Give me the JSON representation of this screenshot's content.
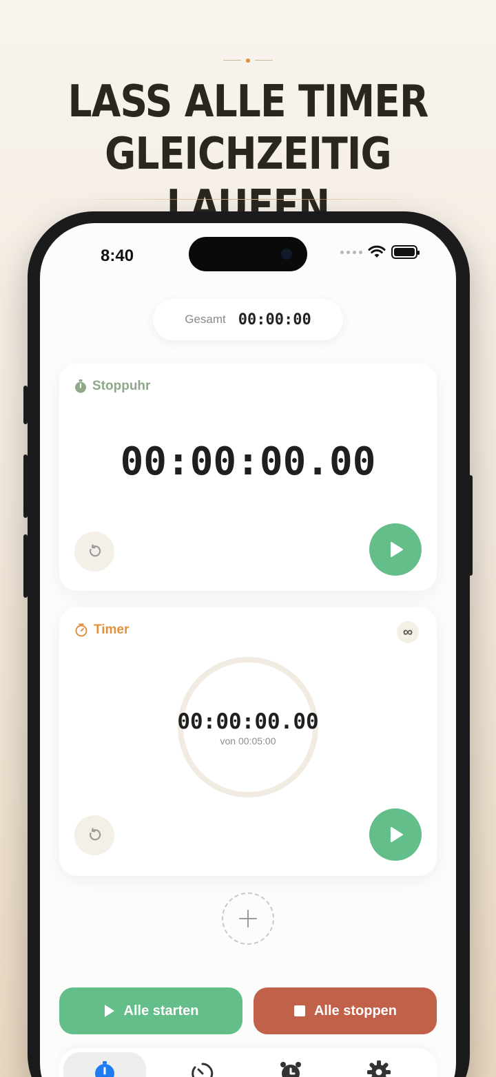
{
  "headline": {
    "line1": "LASS ALLE TIMER",
    "line2": "GLEICHZEITIG LAUFEN"
  },
  "status_bar": {
    "time": "8:40"
  },
  "total": {
    "label": "Gesamt",
    "value": "00:00:00"
  },
  "stopwatch_card": {
    "title": "Stoppuhr",
    "icon": "stopwatch-icon",
    "time": "00:00:00.00",
    "accent": "#8fa98a"
  },
  "timer_card": {
    "title": "Timer",
    "icon": "timer-icon",
    "time": "00:00:00.00",
    "subtitle": "von 00:05:00",
    "loop_symbol": "∞",
    "accent": "#e0913f",
    "progress": 0
  },
  "actions": {
    "start_all": "Alle starten",
    "stop_all": "Alle stoppen"
  },
  "colors": {
    "play": "#64be8a",
    "stop": "#c1614a",
    "tab_active": "#1e7cf0"
  },
  "tabs": [
    {
      "icon": "stopwatch-tab-icon",
      "active": true
    },
    {
      "icon": "timer-tab-icon",
      "active": false
    },
    {
      "icon": "alarm-clock-tab-icon",
      "active": false
    },
    {
      "icon": "gear-tab-icon",
      "active": false
    }
  ]
}
